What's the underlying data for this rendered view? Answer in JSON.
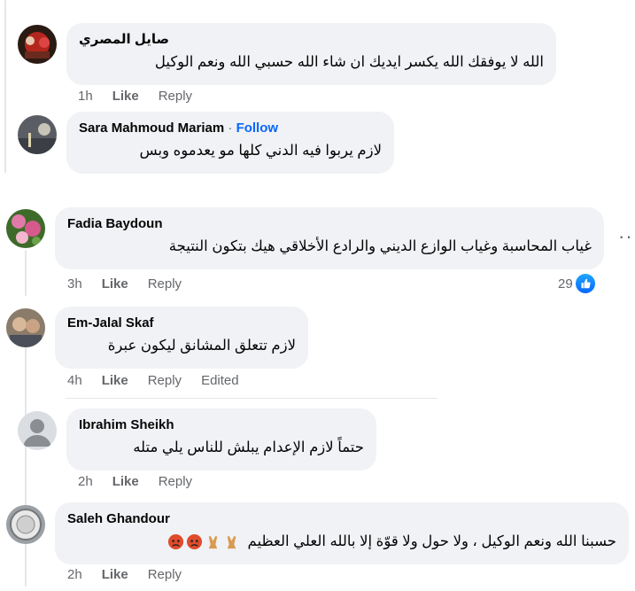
{
  "comments": [
    {
      "name": "صايل المصري",
      "follow": "",
      "text": "الله لا يوفقك الله يكسر ايديك ان شاء الله حسبي الله ونعم الوكيل",
      "time": "1h",
      "like": "Like",
      "reply": "Reply",
      "extra": ""
    },
    {
      "name": "Sara Mahmoud Mariam",
      "follow": "Follow",
      "text": "لازم يربوا فيه الدني كلها مو يعدموه وبس",
      "time": "",
      "like": "",
      "reply": "",
      "extra": ""
    },
    {
      "name": "Fadia Baydoun",
      "follow": "",
      "text": "غياب المحاسبة وغياب الوازع الديني والرادع الأخلاقي هيك بتكون النتيجة",
      "time": "3h",
      "like": "Like",
      "reply": "Reply",
      "extra": "",
      "reactions": "29"
    },
    {
      "name": "Em-Jalal Skaf",
      "follow": "",
      "text": "لازم تتعلق المشانق ليكون عبرة",
      "time": "4h",
      "like": "Like",
      "reply": "Reply",
      "extra": "Edited"
    },
    {
      "name": "Ibrahim Sheikh",
      "follow": "",
      "text": "حتماً لازم الإعدام يبلش للناس يلي متله",
      "time": "2h",
      "like": "Like",
      "reply": "Reply",
      "extra": ""
    },
    {
      "name": "Saleh Ghandour",
      "follow": "",
      "text": "حسبنا الله ونعم الوكيل ، ولا حول ولا قوّة إلا بالله العلي العظيم",
      "time": "2h",
      "like": "Like",
      "reply": "Reply",
      "extra": ""
    }
  ],
  "ui": {
    "follow_separator": "·",
    "more_glyph": "···"
  },
  "colors": {
    "bubble": "#f0f2f5",
    "meta_text": "#65676b",
    "follow_blue": "#0866ff",
    "thread_line": "#e4e6eb"
  },
  "icons": [
    "like-reaction-icon",
    "more-options-icon",
    "pouting-face-emoji",
    "folded-hands-emoji",
    "default-avatar-icon"
  ]
}
